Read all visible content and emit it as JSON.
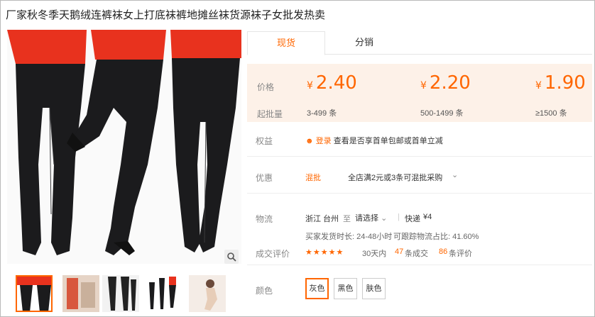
{
  "title": "厂家秋冬季天鹅绒连裤袜女上打底袜裤地摊丝袜货源袜子女批发热卖",
  "tabs": [
    {
      "label": "现货",
      "active": true
    },
    {
      "label": "分销",
      "active": false
    }
  ],
  "price_box": {
    "price_label": "价格",
    "qty_label": "起批量",
    "currency": "¥",
    "tiers": [
      {
        "price": "2.40",
        "qty": "3-499 条"
      },
      {
        "price": "2.20",
        "qty": "500-1499 条"
      },
      {
        "price": "1.90",
        "qty": "≥1500 条"
      }
    ]
  },
  "rights": {
    "label": "权益",
    "login_link": "登录",
    "text": "查看是否享首单包邮或首单立减"
  },
  "promo": {
    "label": "优惠",
    "tag": "混批",
    "text": "全店满2元或3条可混批采购"
  },
  "logistics": {
    "label": "物流",
    "from": "浙江 台州",
    "to_word": "至",
    "to_select": "请选择",
    "express": "快递",
    "fee": "¥4",
    "ship_time": "买家发货时长: 24-48小时",
    "acceptance": "可跟踪物流占比: 41.60%"
  },
  "rating": {
    "label": "成交评价",
    "stars": "★★★★★",
    "days": "30天内",
    "sold_count": "47",
    "sold_label": "条成交",
    "review_count": "86",
    "review_label": "条评价"
  },
  "colors": {
    "label": "颜色",
    "options": [
      "灰色",
      "黑色",
      "肤色"
    ],
    "selected": 0
  },
  "accent": "#ff6600",
  "icons": {
    "zoom": "magnifier-icon",
    "dropdown": "chevron-down-icon",
    "login": "user-icon"
  }
}
